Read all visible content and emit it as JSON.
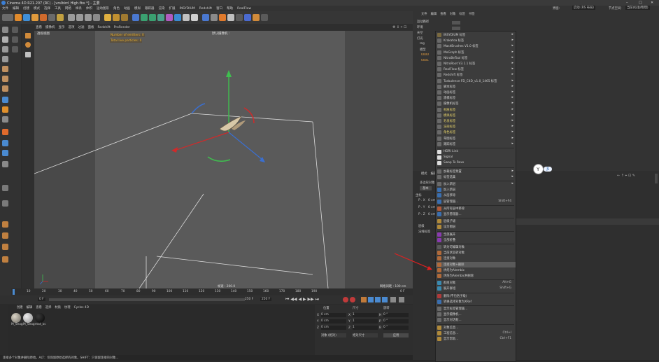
{
  "app": {
    "title": "Cinema 4D R21.207 (RC) - [vrslbird_High.fbx *] - 主要",
    "win_min": "–",
    "win_max": "□",
    "win_close": "✕"
  },
  "menubar": {
    "items": [
      "文件",
      "编辑",
      "创建",
      "模式",
      "选择",
      "工具",
      "网格",
      "样条",
      "体积",
      "运动图形",
      "角色",
      "动画",
      "模拟",
      "跟踪器",
      "渲染",
      "扩展",
      "INSYDIUM",
      "Redshift",
      "窗口",
      "帮助",
      "RealFlow"
    ],
    "right_items": [
      "界面:",
      "启动 (RS 布局)",
      "节点空间:",
      "当前(标准/物理)"
    ]
  },
  "viewport": {
    "menu": [
      "查看",
      "摄像机",
      "显示",
      "选项",
      "过滤",
      "面板",
      "Redshift",
      "ProRender"
    ],
    "label": "透视视图",
    "camera_label": "默认摄像机 :",
    "hud_line1": "Number of emitters: 0",
    "hud_line2": "Total live particles: 0",
    "grid_spacing": "网格间距 : 100 cm",
    "fps": "帧速 : 200.0"
  },
  "timeline": {
    "ticks": [
      "10",
      "20",
      "30",
      "40",
      "50",
      "60",
      "70",
      "80",
      "90",
      "100",
      "110",
      "120",
      "130",
      "140",
      "150",
      "160",
      "170",
      "180",
      "190"
    ],
    "frame_end": "0 F",
    "current_frame": "0 F",
    "range_end": "250 F",
    "range_end2": "250 F",
    "range_start": "0 F"
  },
  "material_manager": {
    "menu": [
      "创建",
      "编辑",
      "查看",
      "选择",
      "材质",
      "纹理",
      "Cycles 4D"
    ],
    "materials": [
      {
        "name": "M_Seag"
      },
      {
        "name": "M_Seag"
      },
      {
        "name": "mat_oc"
      }
    ]
  },
  "coordinates": {
    "headers": [
      "位置",
      "尺寸",
      "旋转"
    ],
    "rows": [
      {
        "axis": "X",
        "pos": "0 cm",
        "size_axis": "X",
        "size": "1",
        "rot_axis": "H",
        "rot": "0 °"
      },
      {
        "axis": "Y",
        "pos": "0 cm",
        "size_axis": "Y",
        "size": "1",
        "rot_axis": "P",
        "rot": "0 °"
      },
      {
        "axis": "Z",
        "pos": "0 cm",
        "size_axis": "Z",
        "size": "1",
        "rot_axis": "B",
        "rot": "0 °"
      }
    ],
    "dropdown1": "对象 (相对)",
    "dropdown2": "绝对尺寸",
    "apply": "应用"
  },
  "status": {
    "text": "连接多个对象并删除原始。ALT：仅保留原始选择的对象。SHIFT：只保留连接的对象..."
  },
  "object_manager": {
    "menu": [
      "文件",
      "编辑",
      "查看",
      "对象",
      "标签",
      "书签"
    ],
    "objects": [
      "运动路径",
      "环境",
      "天空",
      "灯光",
      "Rig",
      "模型",
      "0000",
      "0001"
    ]
  },
  "attribute_manager": {
    "menu": [
      "模式",
      "编辑",
      "用户数据"
    ],
    "label": "多边形对象",
    "tab": "基本",
    "section1": "坐标",
    "fields": [
      {
        "label": "P . X",
        "value": "0 cm"
      },
      {
        "label": "P . Y",
        "value": "0 cm"
      },
      {
        "label": "P . Z",
        "value": "0 cm"
      }
    ],
    "section2": "层级",
    "section3": "法线标签"
  },
  "context_menu": {
    "items": [
      {
        "label": "INSYDIUM 标签",
        "arrow": "▸",
        "color": "#7a6a40"
      },
      {
        "label": "Krakatoa 标签",
        "arrow": "▸",
        "color": "#6a6a6a"
      },
      {
        "label": "MashBrushes V1.0 标签",
        "arrow": "▸",
        "color": "#6a6a6a"
      },
      {
        "label": "MoGraph 标签",
        "arrow": "▸",
        "color": "#6a6a6a"
      },
      {
        "label": "NitroBeTool 标签",
        "arrow": "▸",
        "color": "#6a6a6a"
      },
      {
        "label": "NitroRoot V3.1.1 标签",
        "arrow": "▸",
        "color": "#6a6a6a"
      },
      {
        "label": "RealFlow 标签",
        "arrow": "▸",
        "color": "#6a6a6a"
      },
      {
        "label": "Redshift 标签",
        "arrow": "▸",
        "color": "#6a6a6a"
      },
      {
        "label": "Turbulence FD_C4D_v1.0_1465 标签",
        "arrow": "▸",
        "color": "#6a6a6a"
      },
      {
        "label": "脚本标签",
        "arrow": "▸",
        "color": "#6a6a6a"
      },
      {
        "label": "动画标签",
        "arrow": "▸",
        "color": "#6a6a6a"
      },
      {
        "label": "建模标签",
        "arrow": "▸",
        "color": "#6a6a6a"
      },
      {
        "label": "摄像机标签",
        "arrow": "▸",
        "color": "#6a6a6a"
      },
      {
        "label": "材质标签",
        "arrow": "▸",
        "color": "#6a6a6a",
        "yellow": true
      },
      {
        "label": "模拟标签",
        "arrow": "▸",
        "color": "#6a6a6a",
        "yellow": true
      },
      {
        "label": "毛发标签",
        "arrow": "▸",
        "color": "#6a6a6a",
        "yellow": true
      },
      {
        "label": "渲染标签",
        "arrow": "▸",
        "color": "#6a6a6a",
        "yellow": true
      },
      {
        "label": "角色标签",
        "arrow": "▸",
        "color": "#6a6a6a",
        "yellow": true
      },
      {
        "label": "草图标签",
        "arrow": "▸",
        "color": "#6a6a6a"
      },
      {
        "label": "跟踪标签",
        "arrow": "▸",
        "color": "#6a6a6a"
      },
      {
        "label": "HDRI Link",
        "color": "#dcdcdc"
      },
      {
        "label": "Signal",
        "color": "#dcdcdc"
      },
      {
        "label": "Swap To Rexx",
        "color": "#dcdcdc"
      },
      {
        "label": "加载标签预置",
        "arrow": "▸",
        "color": "#6a6a6a"
      },
      {
        "label": "标签选集",
        "arrow": "▸",
        "color": "#6a6a6a"
      },
      {
        "label": "加入新层",
        "arrow": "▸",
        "color": "#6a6a6a"
      },
      {
        "label": "加入新层",
        "color": "#3a6fb0"
      },
      {
        "label": "从层移除",
        "color": "#3a6fb0"
      },
      {
        "label": "层管理器...",
        "shortcut": "Shift+F4",
        "color": "#3a6fb0"
      },
      {
        "label": "从所有层中移除",
        "color": "#b05a3a"
      },
      {
        "label": "显示管理器...",
        "color": "#3a6fb0"
      },
      {
        "label": "层级子级",
        "color": "#b08a3a"
      },
      {
        "label": "设为图层",
        "color": "#b08a3a"
      },
      {
        "label": "全部展开",
        "color": "#8a3ab0"
      },
      {
        "label": "全部折叠",
        "color": "#8a3ab0"
      },
      {
        "label": "转为可编辑对象",
        "color": "#5a5a5a"
      },
      {
        "label": "当前状态转对象",
        "color": "#b06a3a"
      },
      {
        "label": "连接对象",
        "color": "#b06a3a"
      },
      {
        "label": "连接对象+删除",
        "color": "#b06a3a",
        "highlight": true
      },
      {
        "label": "烘焙为Alembic",
        "color": "#b06a3a"
      },
      {
        "label": "烘焙为Alembic并删除",
        "color": "#b06a3a"
      },
      {
        "label": "群组对象",
        "shortcut": "Alt+G",
        "color": "#3a8ab0"
      },
      {
        "label": "展开群组",
        "shortcut": "Shift+G",
        "color": "#3a8ab0"
      },
      {
        "label": "删除(不包括子级)",
        "color": "#b03a3a"
      },
      {
        "label": "转换选择对象为XRef",
        "color": "#3a6fb0"
      },
      {
        "label": "显示标签管理器...",
        "color": "#6a6a6a"
      },
      {
        "label": "显示摄像机...",
        "color": "#6a6a6a"
      },
      {
        "label": "显示对话框...",
        "color": "#6a6a6a"
      },
      {
        "label": "对象信息...",
        "color": "#b08a3a"
      },
      {
        "label": "工程信息...",
        "shortcut": "Ctrl+I",
        "color": "#b08a3a"
      },
      {
        "label": "显示帮助...",
        "shortcut": "Ctrl+F1",
        "color": "#b08a3a"
      }
    ]
  },
  "cursor_label": "多"
}
